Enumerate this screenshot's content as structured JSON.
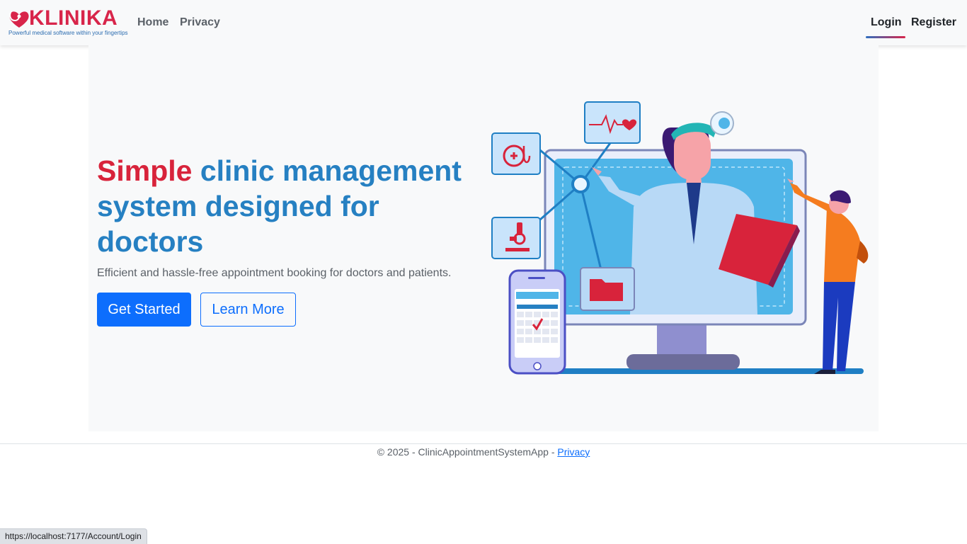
{
  "brand": {
    "name": "KLINIKA",
    "tagline": "Powerful medical software within your fingertips",
    "brand_color": "#d8254a"
  },
  "nav": {
    "home": "Home",
    "privacy": "Privacy",
    "login": "Login",
    "register": "Register"
  },
  "hero": {
    "headline_accent": "Simple",
    "headline_rest": "clinic management system designed for doctors",
    "subtext": "Efficient and hassle-free appointment booking for doctors and patients.",
    "primary_button": "Get Started",
    "secondary_button": "Learn More",
    "accent_color": "#d8233b",
    "headline_color": "#2680c2"
  },
  "footer": {
    "copyright": "© 2025 - ClinicAppointmentSystemApp - ",
    "privacy_link": "Privacy"
  },
  "status_bar": {
    "url": "https://localhost:7177/Account/Login"
  },
  "icons": [
    "stethoscope-icon",
    "heartbeat-icon",
    "microscope-icon",
    "folder-icon",
    "calendar-phone-icon"
  ]
}
